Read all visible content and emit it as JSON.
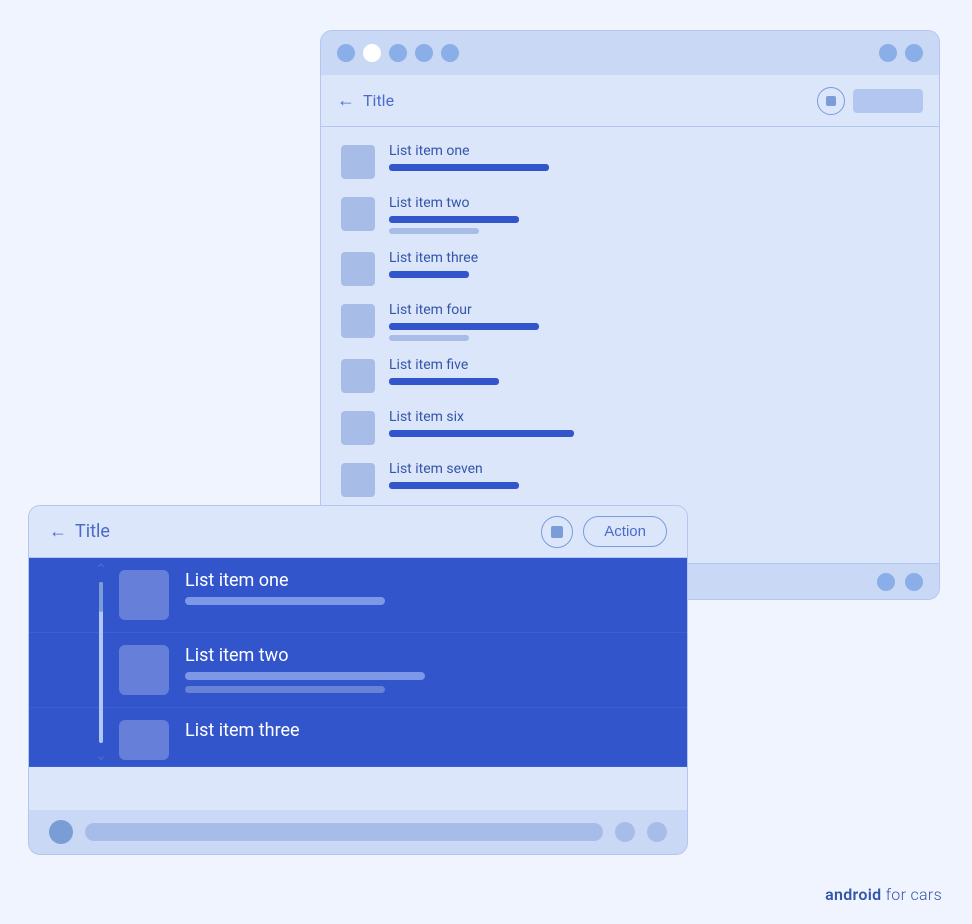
{
  "back_window": {
    "title": "Title",
    "action_label": "",
    "list_items": [
      {
        "label": "List item one",
        "bar1_width": 160,
        "bar2_width": 0
      },
      {
        "label": "List item two",
        "bar1_width": 130,
        "bar2_width": 90
      },
      {
        "label": "List item three",
        "bar1_width": 80,
        "bar2_width": 0
      },
      {
        "label": "List item four",
        "bar1_width": 150,
        "bar2_width": 80
      },
      {
        "label": "List item five",
        "bar1_width": 110,
        "bar2_width": 0
      },
      {
        "label": "List item six",
        "bar1_width": 185,
        "bar2_width": 0
      },
      {
        "label": "List item seven",
        "bar1_width": 130,
        "bar2_width": 0
      }
    ]
  },
  "front_window": {
    "title": "Title",
    "action_label": "Action",
    "list_items": [
      {
        "label": "List item one",
        "bar1_width": 200,
        "bar2_width": 0,
        "selected": true
      },
      {
        "label": "List item two",
        "bar1_width": 240,
        "bar2_width": 200,
        "selected": true
      },
      {
        "label": "List item three",
        "bar1_width": 160,
        "bar2_width": 0,
        "selected": true
      }
    ]
  },
  "brand": {
    "prefix": "android",
    "suffix": " for cars"
  }
}
